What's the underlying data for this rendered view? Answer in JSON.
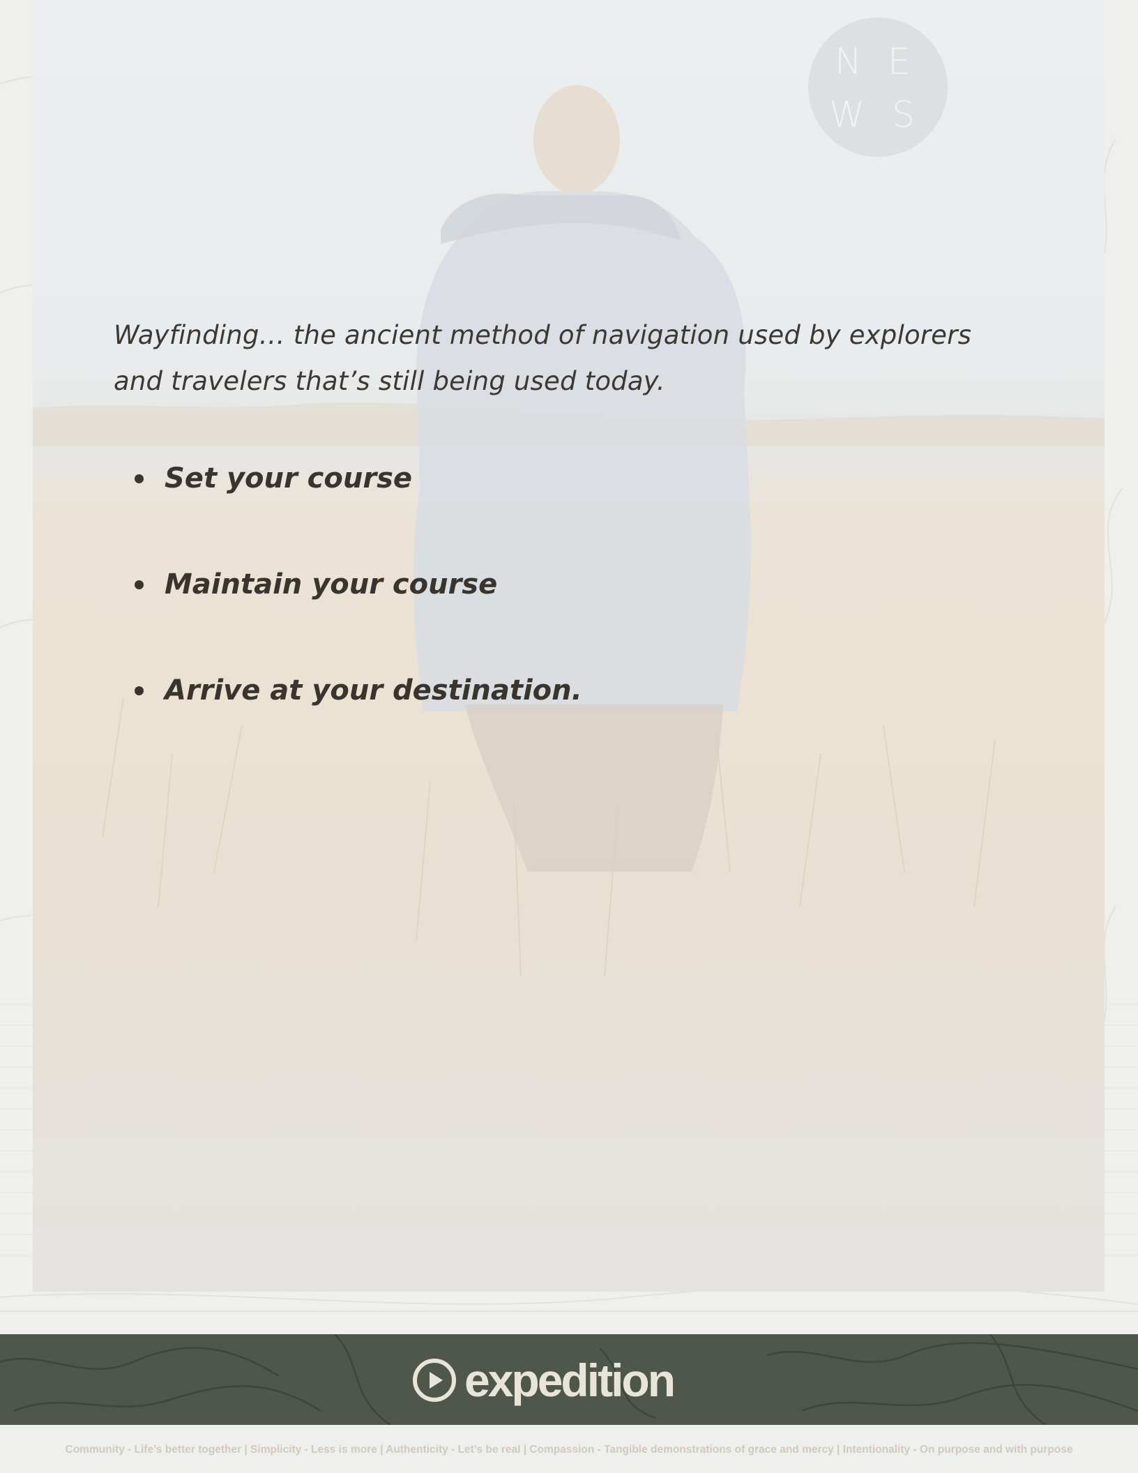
{
  "compass": {
    "letters": [
      "N",
      "E",
      "W",
      "S"
    ]
  },
  "intro": {
    "text": "Wayfinding… the ancient method of navigation used by explorers and travelers that’s still being used today."
  },
  "points": [
    {
      "label": "Set your course"
    },
    {
      "label": "Maintain your course"
    },
    {
      "label": "Arrive at your destination."
    }
  ],
  "footer": {
    "logo_text": "expedition",
    "values_line": "Community - Life’s better together | Simplicity - Less is more | Authenticity - Let’s be real | Compassion - Tangible demonstrations of grace and mercy | Intentionality - On purpose and with purpose"
  },
  "colors": {
    "text": "#3a342e",
    "footer_band": "#4f564c",
    "logo": "#e9e4da",
    "values_text": "#d2c9bd"
  }
}
